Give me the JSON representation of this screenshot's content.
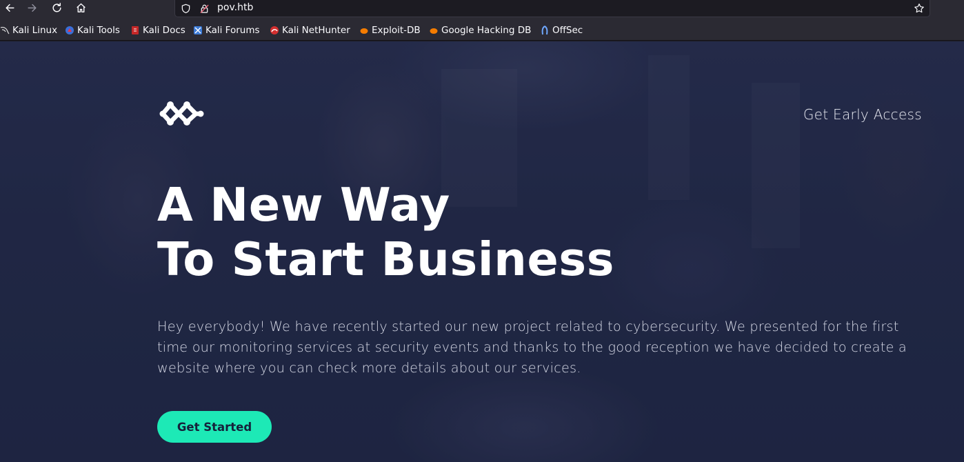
{
  "browser": {
    "url": "pov.htb",
    "bookmarks": [
      {
        "label": "Kali Linux",
        "icon": "kali-dragon-icon"
      },
      {
        "label": "Kali Tools",
        "icon": "kali-tools-icon"
      },
      {
        "label": "Kali Docs",
        "icon": "kali-docs-icon"
      },
      {
        "label": "Kali Forums",
        "icon": "kali-forums-icon"
      },
      {
        "label": "Kali NetHunter",
        "icon": "kali-nethunter-icon"
      },
      {
        "label": "Exploit-DB",
        "icon": "exploit-db-icon"
      },
      {
        "label": "Google Hacking DB",
        "icon": "ghdb-icon"
      },
      {
        "label": "OffSec",
        "icon": "offsec-icon"
      }
    ]
  },
  "page": {
    "nav_link": "Get Early Access",
    "headline_line1": "A New Way",
    "headline_line2": "To Start Business",
    "lead": "Hey everybody! We have recently started our new project related to cybersecurity. We presented for the first time our monitoring services at security events and thanks to the good reception we have decided to create a website where you can check more details about our services.",
    "cta": "Get Started"
  },
  "colors": {
    "accent": "#1de9b6",
    "hero_overlay": "#252c4a",
    "chrome": "#2b2a33"
  }
}
